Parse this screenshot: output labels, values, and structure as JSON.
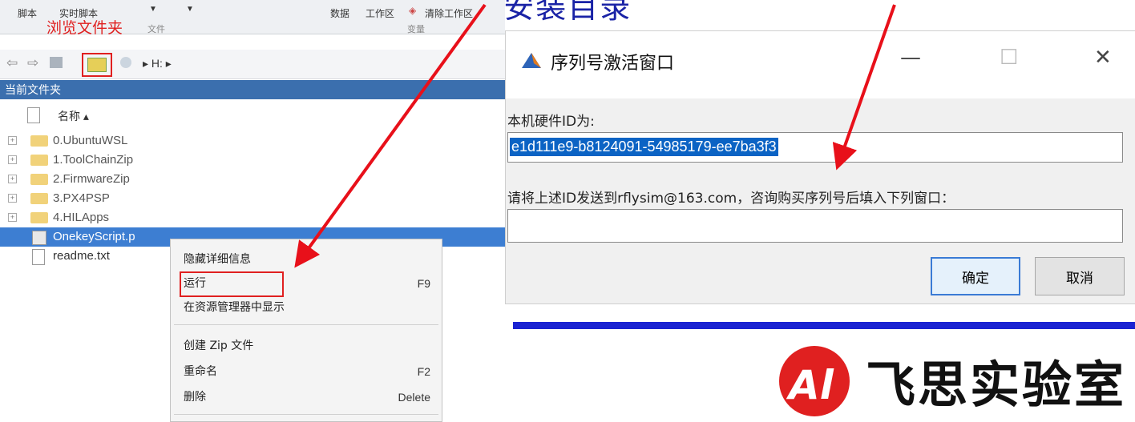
{
  "heading": {
    "text": "将OnekeyScript.p拷贝到安装目录"
  },
  "toolstrip": {
    "script_label": "脚本",
    "live_script_label": "实时脚本",
    "data_label": "数据",
    "workspace_label": "工作区",
    "clear_workspace_label": "清除工作区",
    "file_section": "文件",
    "variable_section": "变量"
  },
  "annotation": {
    "browse_folder": "浏览文件夹"
  },
  "address_bar": {
    "path": "▸ H: ▸"
  },
  "current_folder": {
    "title": "当前文件夹",
    "name_header": "名称 ▴",
    "items": [
      {
        "name": "0.UbuntuWSL"
      },
      {
        "name": "1.ToolChainZip"
      },
      {
        "name": "2.FirmwareZip"
      },
      {
        "name": "3.PX4PSP"
      },
      {
        "name": "4.HILApps"
      },
      {
        "name": "OnekeyScript.p"
      },
      {
        "name": "readme.txt"
      }
    ]
  },
  "context_menu": {
    "items": [
      {
        "label": "隐藏详细信息",
        "shortcut": ""
      },
      {
        "label": "运行",
        "shortcut": "F9"
      },
      {
        "label": "在资源管理器中显示",
        "shortcut": ""
      },
      {
        "label": "创建 Zip 文件",
        "shortcut": ""
      },
      {
        "label": "重命名",
        "shortcut": "F2"
      },
      {
        "label": "删除",
        "shortcut": "Delete"
      }
    ]
  },
  "dialog": {
    "title": "序列号激活窗口",
    "minimize": "—",
    "maximize": "☐",
    "close": "✕",
    "hardware_label": "本机硬件ID为:",
    "hardware_id": "e1d111e9-b8124091-54985179-ee7ba3f3",
    "instruction": "请将上述ID发送到rflysim@163.com，咨询购买序列号后填入下列窗口：",
    "serial_value": "",
    "ok_label": "确定",
    "cancel_label": "取消"
  },
  "logo": {
    "text": "飞思实验室"
  },
  "colors": {
    "heading": "#1a23a6",
    "annotation_red": "#e02020",
    "band_blue": "#1a23d2",
    "logo_red": "#e02020"
  }
}
